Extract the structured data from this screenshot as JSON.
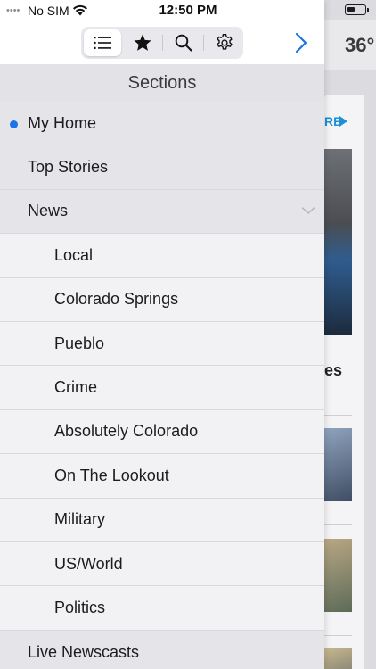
{
  "status_bar": {
    "signal_dots": "••••",
    "carrier": "No SIM",
    "time": "12:50 PM"
  },
  "toolbar": {
    "tabs": [
      {
        "name": "list-icon",
        "active": true
      },
      {
        "name": "star-icon",
        "active": false
      },
      {
        "name": "search-icon",
        "active": false
      },
      {
        "name": "gear-icon",
        "active": false
      }
    ],
    "forward_icon": "chevron-right-icon",
    "accent_color": "#1a73e8"
  },
  "drawer": {
    "title": "Sections",
    "items": [
      {
        "label": "My Home",
        "level": "top",
        "selected": true
      },
      {
        "label": "Top Stories",
        "level": "top"
      },
      {
        "label": "News",
        "level": "top",
        "expanded": true
      },
      {
        "label": "Local",
        "level": "sub"
      },
      {
        "label": "Colorado Springs",
        "level": "sub"
      },
      {
        "label": "Pueblo",
        "level": "sub"
      },
      {
        "label": "Crime",
        "level": "sub"
      },
      {
        "label": "Absolutely Colorado",
        "level": "sub"
      },
      {
        "label": "On The Lookout",
        "level": "sub"
      },
      {
        "label": "Military",
        "level": "sub"
      },
      {
        "label": "US/World",
        "level": "sub"
      },
      {
        "label": "Politics",
        "level": "sub"
      },
      {
        "label": "Live Newscasts",
        "level": "top"
      }
    ]
  },
  "background": {
    "temperature": "36°",
    "more_label": "RE",
    "headline_fragment": "es"
  }
}
